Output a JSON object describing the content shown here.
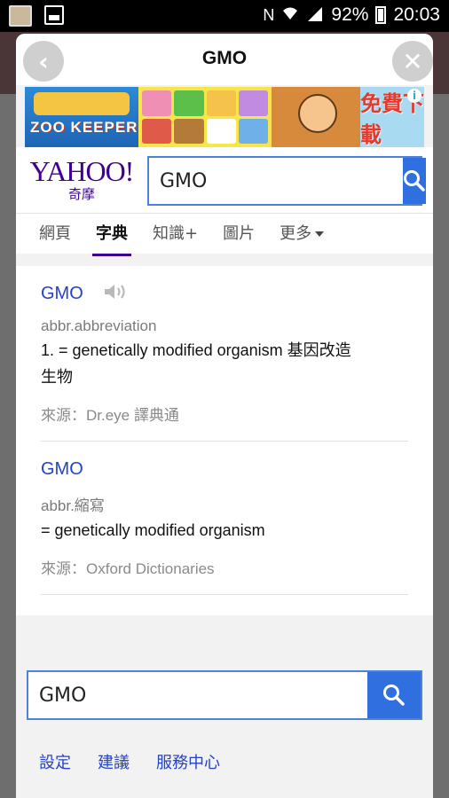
{
  "status_bar": {
    "battery": "92%",
    "time": "20:03",
    "icons": [
      "nfc-icon",
      "wifi-icon",
      "signal-icon",
      "battery-icon"
    ]
  },
  "dialog": {
    "title": "GMO",
    "back_icon": "chevron-left-icon",
    "close_icon": "close-icon"
  },
  "ad": {
    "logo_text": "ZOO KEEPER",
    "cta_text": "免費下載",
    "info_icon": "info-icon"
  },
  "header": {
    "logo_word": "YAHOO!",
    "logo_sub": "奇摩",
    "search_value": "GMO",
    "search_icon": "search-icon"
  },
  "tabs": [
    {
      "label": "網頁",
      "active": false
    },
    {
      "label": "字典",
      "active": true
    },
    {
      "label": "知識+",
      "active": false
    },
    {
      "label": "圖片",
      "active": false
    },
    {
      "label": "更多",
      "active": false
    }
  ],
  "results": [
    {
      "headword": "GMO",
      "has_audio": true,
      "pos": "abbr.abbreviation",
      "definition_line1": "1. = genetically modified organism 基因改造",
      "definition_line2": "生物",
      "source": "來源：Dr.eye 譯典通"
    },
    {
      "headword": "GMO",
      "has_audio": false,
      "pos": "abbr.縮寫",
      "definition_line1": "= genetically modified organism",
      "source": "來源：Oxford Dictionaries"
    }
  ],
  "bottom": {
    "search_value": "GMO",
    "links": [
      "設定",
      "建議",
      "服務中心"
    ]
  },
  "colors": {
    "accent_blue": "#2f6fe0",
    "link_blue": "#2441c8",
    "yahoo_purple": "#400090"
  }
}
